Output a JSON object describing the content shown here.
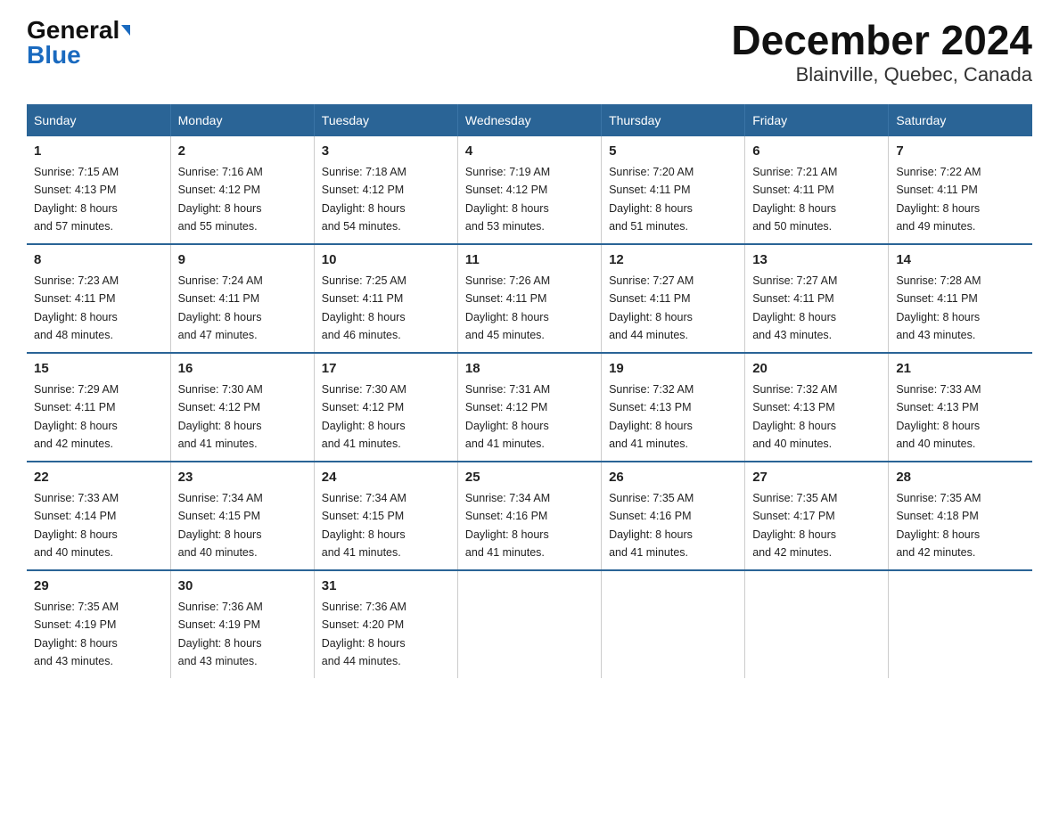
{
  "header": {
    "logo_general": "General",
    "logo_blue": "Blue",
    "title": "December 2024",
    "subtitle": "Blainville, Quebec, Canada"
  },
  "days_of_week": [
    "Sunday",
    "Monday",
    "Tuesday",
    "Wednesday",
    "Thursday",
    "Friday",
    "Saturday"
  ],
  "weeks": [
    [
      {
        "day": "1",
        "sunrise": "7:15 AM",
        "sunset": "4:13 PM",
        "daylight": "8 hours and 57 minutes."
      },
      {
        "day": "2",
        "sunrise": "7:16 AM",
        "sunset": "4:12 PM",
        "daylight": "8 hours and 55 minutes."
      },
      {
        "day": "3",
        "sunrise": "7:18 AM",
        "sunset": "4:12 PM",
        "daylight": "8 hours and 54 minutes."
      },
      {
        "day": "4",
        "sunrise": "7:19 AM",
        "sunset": "4:12 PM",
        "daylight": "8 hours and 53 minutes."
      },
      {
        "day": "5",
        "sunrise": "7:20 AM",
        "sunset": "4:11 PM",
        "daylight": "8 hours and 51 minutes."
      },
      {
        "day": "6",
        "sunrise": "7:21 AM",
        "sunset": "4:11 PM",
        "daylight": "8 hours and 50 minutes."
      },
      {
        "day": "7",
        "sunrise": "7:22 AM",
        "sunset": "4:11 PM",
        "daylight": "8 hours and 49 minutes."
      }
    ],
    [
      {
        "day": "8",
        "sunrise": "7:23 AM",
        "sunset": "4:11 PM",
        "daylight": "8 hours and 48 minutes."
      },
      {
        "day": "9",
        "sunrise": "7:24 AM",
        "sunset": "4:11 PM",
        "daylight": "8 hours and 47 minutes."
      },
      {
        "day": "10",
        "sunrise": "7:25 AM",
        "sunset": "4:11 PM",
        "daylight": "8 hours and 46 minutes."
      },
      {
        "day": "11",
        "sunrise": "7:26 AM",
        "sunset": "4:11 PM",
        "daylight": "8 hours and 45 minutes."
      },
      {
        "day": "12",
        "sunrise": "7:27 AM",
        "sunset": "4:11 PM",
        "daylight": "8 hours and 44 minutes."
      },
      {
        "day": "13",
        "sunrise": "7:27 AM",
        "sunset": "4:11 PM",
        "daylight": "8 hours and 43 minutes."
      },
      {
        "day": "14",
        "sunrise": "7:28 AM",
        "sunset": "4:11 PM",
        "daylight": "8 hours and 43 minutes."
      }
    ],
    [
      {
        "day": "15",
        "sunrise": "7:29 AM",
        "sunset": "4:11 PM",
        "daylight": "8 hours and 42 minutes."
      },
      {
        "day": "16",
        "sunrise": "7:30 AM",
        "sunset": "4:12 PM",
        "daylight": "8 hours and 41 minutes."
      },
      {
        "day": "17",
        "sunrise": "7:30 AM",
        "sunset": "4:12 PM",
        "daylight": "8 hours and 41 minutes."
      },
      {
        "day": "18",
        "sunrise": "7:31 AM",
        "sunset": "4:12 PM",
        "daylight": "8 hours and 41 minutes."
      },
      {
        "day": "19",
        "sunrise": "7:32 AM",
        "sunset": "4:13 PM",
        "daylight": "8 hours and 41 minutes."
      },
      {
        "day": "20",
        "sunrise": "7:32 AM",
        "sunset": "4:13 PM",
        "daylight": "8 hours and 40 minutes."
      },
      {
        "day": "21",
        "sunrise": "7:33 AM",
        "sunset": "4:13 PM",
        "daylight": "8 hours and 40 minutes."
      }
    ],
    [
      {
        "day": "22",
        "sunrise": "7:33 AM",
        "sunset": "4:14 PM",
        "daylight": "8 hours and 40 minutes."
      },
      {
        "day": "23",
        "sunrise": "7:34 AM",
        "sunset": "4:15 PM",
        "daylight": "8 hours and 40 minutes."
      },
      {
        "day": "24",
        "sunrise": "7:34 AM",
        "sunset": "4:15 PM",
        "daylight": "8 hours and 41 minutes."
      },
      {
        "day": "25",
        "sunrise": "7:34 AM",
        "sunset": "4:16 PM",
        "daylight": "8 hours and 41 minutes."
      },
      {
        "day": "26",
        "sunrise": "7:35 AM",
        "sunset": "4:16 PM",
        "daylight": "8 hours and 41 minutes."
      },
      {
        "day": "27",
        "sunrise": "7:35 AM",
        "sunset": "4:17 PM",
        "daylight": "8 hours and 42 minutes."
      },
      {
        "day": "28",
        "sunrise": "7:35 AM",
        "sunset": "4:18 PM",
        "daylight": "8 hours and 42 minutes."
      }
    ],
    [
      {
        "day": "29",
        "sunrise": "7:35 AM",
        "sunset": "4:19 PM",
        "daylight": "8 hours and 43 minutes."
      },
      {
        "day": "30",
        "sunrise": "7:36 AM",
        "sunset": "4:19 PM",
        "daylight": "8 hours and 43 minutes."
      },
      {
        "day": "31",
        "sunrise": "7:36 AM",
        "sunset": "4:20 PM",
        "daylight": "8 hours and 44 minutes."
      },
      null,
      null,
      null,
      null
    ]
  ],
  "labels": {
    "sunrise": "Sunrise:",
    "sunset": "Sunset:",
    "daylight": "Daylight:"
  }
}
